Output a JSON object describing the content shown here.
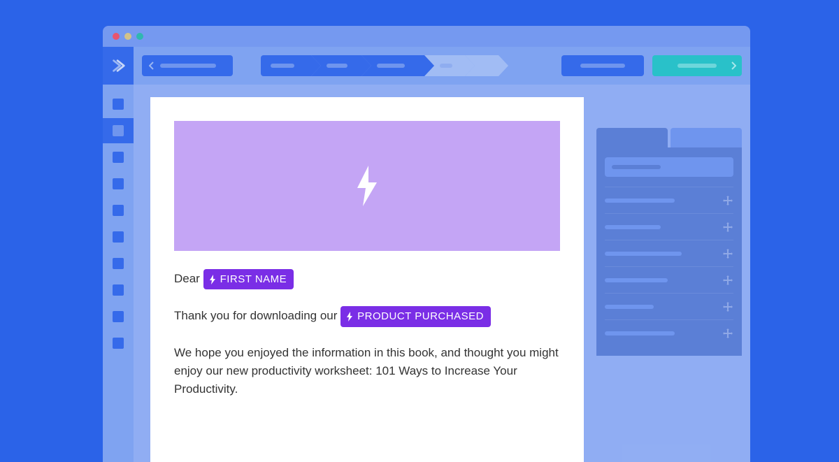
{
  "email": {
    "greeting_prefix": "Dear",
    "tag_first_name": "FIRST NAME",
    "line2_prefix": "Thank you for downloading our",
    "tag_product": "PRODUCT PURCHASED",
    "body_text": "We hope you enjoyed the information in this book, and thought you might enjoy our new productivity worksheet: 101 Ways to Increase Your Productivity."
  },
  "colors": {
    "page_bg": "#2b63e8",
    "accent": "#356aea",
    "hero": "#c4a5f5",
    "tag": "#7a2ee6",
    "teal": "#29c1c9"
  }
}
